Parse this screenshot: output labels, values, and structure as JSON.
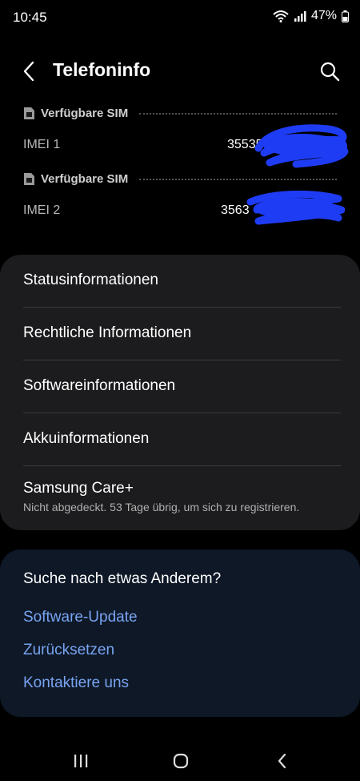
{
  "status": {
    "time": "10:45",
    "battery": "47%",
    "icons": [
      "wifi-icon",
      "signal-icon",
      "battery-icon"
    ]
  },
  "header": {
    "title": "Telefoninfo",
    "icons": [
      "back-arrow-icon",
      "search-icon"
    ]
  },
  "sims": [
    {
      "label": "Verfügbare SIM",
      "imei_label": "IMEI 1",
      "imei_visible": "35535"
    },
    {
      "label": "Verfügbare SIM",
      "imei_label": "IMEI 2",
      "imei_visible": "3563"
    }
  ],
  "menu": {
    "items": [
      {
        "label": "Statusinformationen"
      },
      {
        "label": "Rechtliche Informationen"
      },
      {
        "label": "Softwareinformationen"
      },
      {
        "label": "Akkuinformationen"
      },
      {
        "label": "Samsung Care+",
        "sub": "Nicht abgedeckt. 53 Tage übrig, um sich zu registrieren."
      }
    ]
  },
  "suggestions": {
    "title": "Suche nach etwas Anderem?",
    "links": [
      "Software-Update",
      "Zurücksetzen",
      "Kontaktiere uns"
    ]
  },
  "colors": {
    "background": "#000000",
    "card": "#1c1c1e",
    "suggestion_card": "#0e1827",
    "link": "#79a4f2",
    "redaction": "#1f3cf5"
  },
  "navbar": {
    "icons": [
      "recent-apps-icon",
      "home-icon",
      "back-icon"
    ]
  }
}
